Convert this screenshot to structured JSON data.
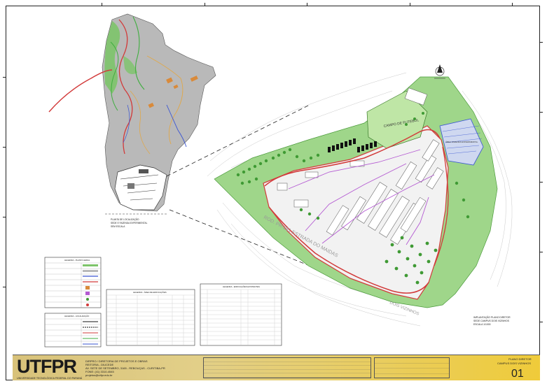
{
  "drawing": {
    "location_plan_label": "PLANTA DE LOCALIZAÇÃO\nSEDE E FAZENDA EXPERIMENTAL\nSEM ESCALA",
    "implantation_label": "IMPLANTAÇÃO PLANO DIRETOR\nSEDE CAMPUS DOIS VIZINHOS\nESCALA 1/1000",
    "field_label": "CAMPO DE FUTEBOL",
    "road_label_1": "ROD. PR-281 ESTRADA DO MAIDAS",
    "road_label_2": "DOIS VIZINHOS",
    "area_label": "ÁREA FAZENDA EXPERIMENTAL"
  },
  "legends": {
    "legend1_title": "LEGENDA - PLANTA GERAL",
    "legend2_title": "LEGENDA - LOCALIZAÇÃO",
    "table1_title": "LEGENDA - ÁREA DE EDIFICAÇÕES",
    "table2_title": "LEGENDA - EDIFICAÇÕES EXISTENTES"
  },
  "title_block": {
    "logo_text": "UTFPR",
    "university": "UNIVERSIDADE TECNOLÓGICA FEDERAL DO PARANÁ",
    "dept_line1": "DIRPRO / DIRETORIA DE PROJETOS E OBRAS",
    "dept_line2": "REITORIA - DIUCEDE",
    "dept_line3": "AV. SETE DE SETEMBRO, 3165 - REBOUÇAS - CURITIBA-PR",
    "dept_line4": "FONE: (41) 3310-4545",
    "dept_line5": "projetos@utfpr.edu.br",
    "project_title": "PLANO DIRETOR",
    "project_subtitle": "CAMPUS DOIS VIZINHOS",
    "sheet_number": "01"
  },
  "colors": {
    "title_block_gold": "#efcb3a",
    "terrain_gray": "#b9b9b9",
    "vegetation_green": "#7dc46a",
    "road_red": "#d23a3a",
    "building_purple": "#b45ad2"
  }
}
